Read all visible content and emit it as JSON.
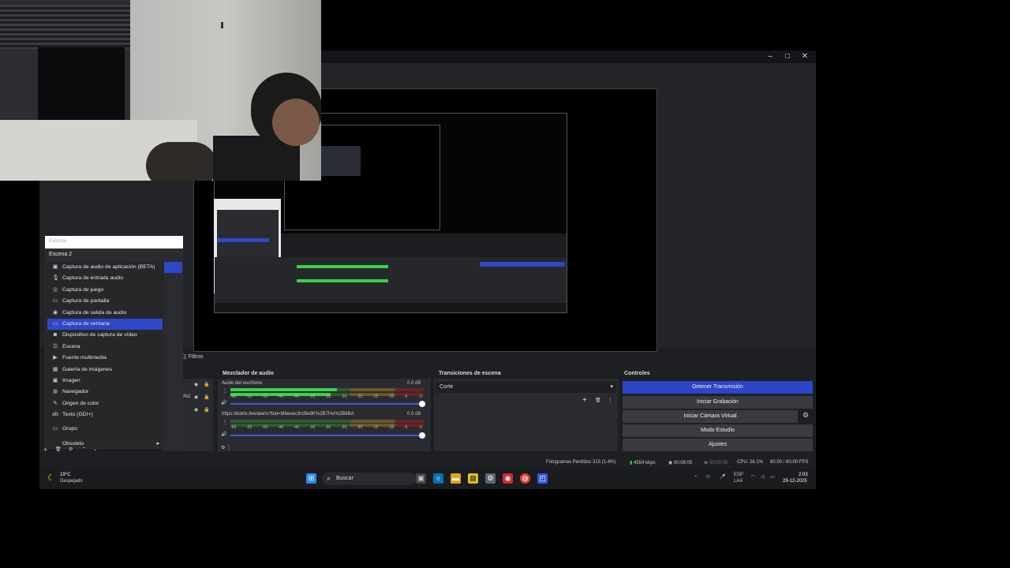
{
  "window": {
    "minimize": "–",
    "maximize": "□",
    "close": "✕"
  },
  "scene_input_placeholder": "Escenas",
  "scene_name": "Escena 2",
  "source_menu": {
    "items": [
      {
        "label": "Captura de audio de aplicación (BETA)",
        "icon": "speaker-icon",
        "glyph": "▣"
      },
      {
        "label": "Captura de entrada audio",
        "icon": "mic-icon",
        "glyph": "🎙"
      },
      {
        "label": "Captura de juego",
        "icon": "gamepad-icon",
        "glyph": "◎"
      },
      {
        "label": "Captura de pantalla",
        "icon": "monitor-icon",
        "glyph": "▭"
      },
      {
        "label": "Captura de salida de audio",
        "icon": "speaker-icon",
        "glyph": "◉"
      },
      {
        "label": "Captura de ventana",
        "icon": "window-icon",
        "glyph": "▭"
      },
      {
        "label": "Dispositivo de captura de vídeo",
        "icon": "camera-icon",
        "glyph": "◙"
      },
      {
        "label": "Escena",
        "icon": "list-icon",
        "glyph": "☰"
      },
      {
        "label": "Fuente multimedia",
        "icon": "play-icon",
        "glyph": "▶"
      },
      {
        "label": "Galería de imágenes",
        "icon": "gallery-icon",
        "glyph": "▦"
      },
      {
        "label": "Imagen",
        "icon": "image-icon",
        "glyph": "▣"
      },
      {
        "label": "Navegador",
        "icon": "globe-icon",
        "glyph": "◍"
      },
      {
        "label": "Origen de color",
        "icon": "brush-icon",
        "glyph": "✎"
      },
      {
        "label": "Texto (GDI+)",
        "icon": "text-icon",
        "glyph": "ab"
      },
      {
        "label": "Grupo",
        "icon": "folder-icon",
        "glyph": "▭"
      },
      {
        "label": "Obsoleto",
        "icon": "none",
        "glyph": ""
      }
    ],
    "selected_index": 5,
    "submenu_arrow": "▸"
  },
  "tabs": {
    "filters": "Filtros"
  },
  "sources_row_text": "%2B7Hvi%2",
  "mixer": {
    "title": "Mezclador de audio",
    "channels": [
      {
        "name": "Audio del escritorio",
        "db": "0.0 dB",
        "level": 0.55
      },
      {
        "name": "https://botrix.live/alerts?bid=M8eoec3rzBe9K%2B7Hvi%2B8BA",
        "db": "0.0 dB",
        "level": 0.0
      }
    ],
    "scale": [
      "-60",
      "-55",
      "-50",
      "-45",
      "-40",
      "-35",
      "-30",
      "-25",
      "-20",
      "-15",
      "-10",
      "-5",
      "0"
    ]
  },
  "transitions": {
    "title": "Transiciones de escena",
    "selected": "Corte"
  },
  "controls": {
    "title": "Controles",
    "buttons": [
      "Detener Transmisión",
      "Iniciar Grabación",
      "Iniciar Cámara Virtual",
      "Modo Estudio",
      "Ajustes"
    ]
  },
  "status": {
    "dropped": "Fotogramas Perdidos 315 (1.4%)",
    "bitrate": "4554 kbps",
    "stream_time": "00:06:05",
    "rec_time": "00:00:00",
    "cpu": "CPU: 26.1%",
    "fps": "60.00 / 60.00 FPS"
  },
  "taskbar": {
    "weather_temp": "19°C",
    "weather_desc": "Despejado",
    "search": "Buscar",
    "lang1": "ESP",
    "lang2": "LAA",
    "time": "2:03",
    "date": "29-12-2025"
  },
  "colors": {
    "accent": "#2c45c9",
    "meter_green": "#3bd14a",
    "meter_yellow": "#c8b92c",
    "meter_red": "#c0262c"
  }
}
